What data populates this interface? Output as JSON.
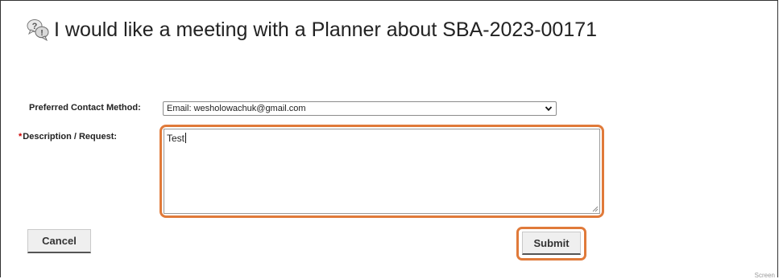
{
  "header": {
    "title": "I would like a meeting with a Planner about SBA-2023-00171",
    "icon": "speech-bubbles-question-icon"
  },
  "form": {
    "contact_label": "Preferred Contact Method:",
    "contact_value": "Email: wesholowachuk@gmail.com",
    "description_required_mark": "*",
    "description_label": "Description / Request:",
    "description_value": "Test"
  },
  "buttons": {
    "cancel_label": "Cancel",
    "submit_label": "Submit"
  },
  "footer": {
    "corner_text": "Screen"
  },
  "colors": {
    "highlight": "#e07a3a",
    "required": "#cc0000"
  }
}
